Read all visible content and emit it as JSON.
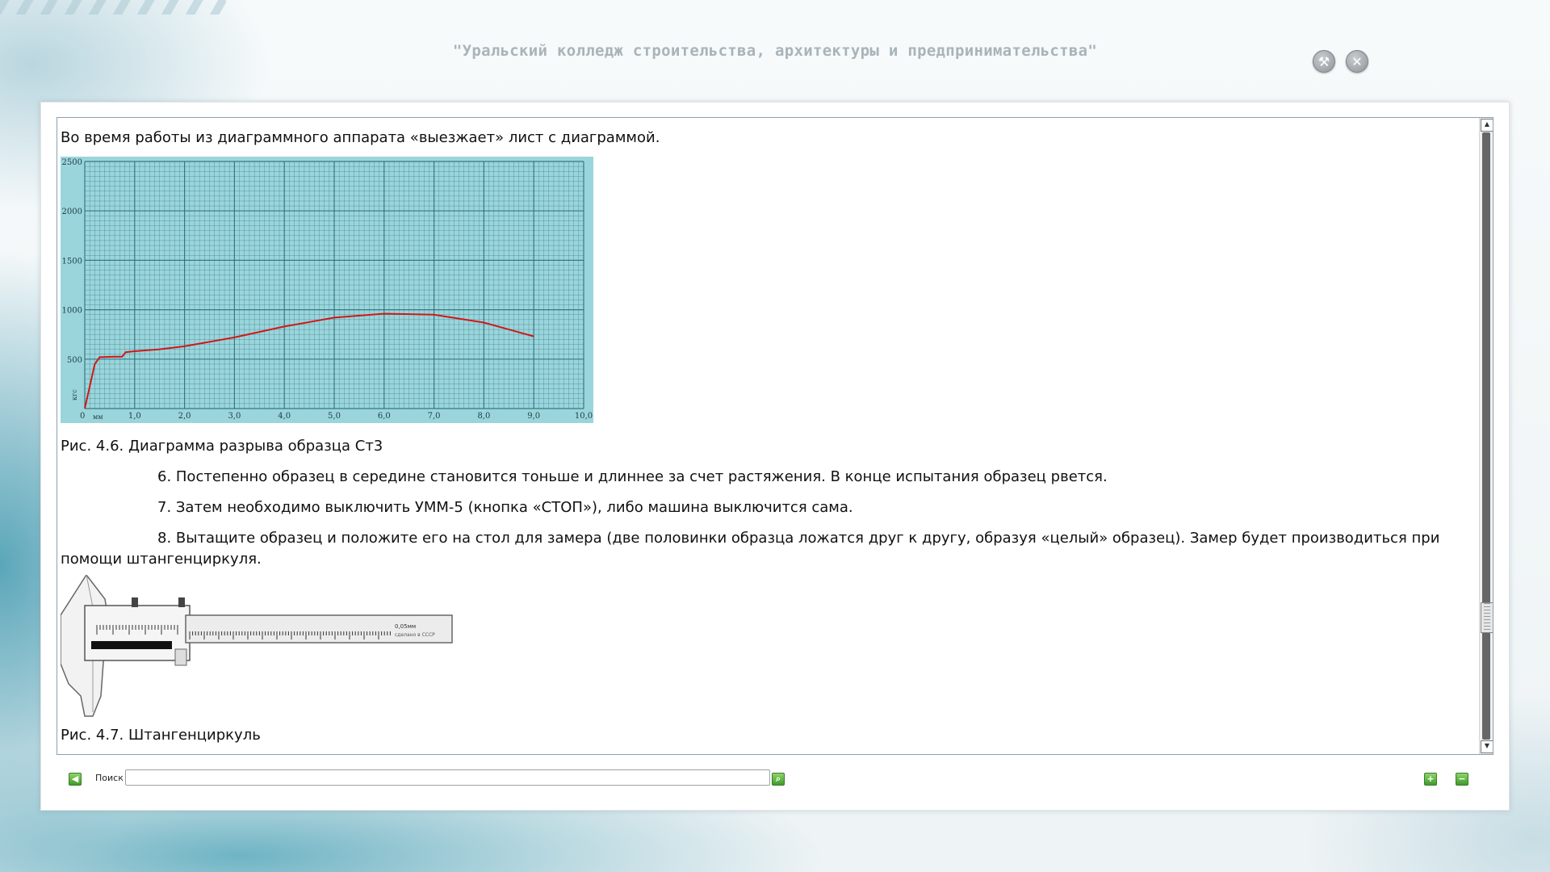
{
  "header": {
    "title": "\"Уральский колледж строительства,  архитектуры и предпринимательства\""
  },
  "content": {
    "intro": "Во время работы из диаграммного аппарата «выезжает» лист с диаграммой.",
    "figure1_caption": "Рис. 4.6. Диаграмма разрыва образца Ст3",
    "step6": "6.  Постепенно образец в середине становится тоньше и длиннее за счет растяжения. В конце испытания образец рвется.",
    "step7": "7.  Затем необходимо выключить УММ-5 (кнопка «СТОП»), либо машина выключится сама.",
    "step8": "8.  Вытащите образец и положите его на стол для замера (две половинки образца ложатся друг к другу, образуя «целый» образец). Замер будет производиться при помощи штангенциркуля.",
    "figure2_caption": "Рис. 4.7. Штангенциркуль",
    "caliper_text": "0,05мм",
    "caliper_text2": "сделано в СССР"
  },
  "toolbar": {
    "search_label": "Поиск",
    "search_value": ""
  },
  "chart_data": {
    "type": "line",
    "x_unit": "мм",
    "y_unit": "кгс",
    "xlim": [
      0,
      10
    ],
    "ylim": [
      0,
      2500
    ],
    "x_ticks": [
      "0",
      "1,0",
      "2,0",
      "3,0",
      "4,0",
      "5,0",
      "6,0",
      "7,0",
      "8,0",
      "9,0",
      "10,0"
    ],
    "y_ticks": [
      "500",
      "1000",
      "1500",
      "2000",
      "2500"
    ],
    "grid": true,
    "background": "#9bd5dc",
    "line_color": "#d01818",
    "series": [
      {
        "x": [
          0,
          0.2,
          0.3,
          0.6,
          0.75,
          0.82,
          1.0,
          1.5,
          2.0,
          3.0,
          4.0,
          5.0,
          6.0,
          7.0,
          8.0,
          9.0
        ],
        "y": [
          0,
          450,
          520,
          525,
          525,
          570,
          580,
          600,
          630,
          720,
          830,
          920,
          960,
          950,
          870,
          730
        ]
      }
    ]
  }
}
